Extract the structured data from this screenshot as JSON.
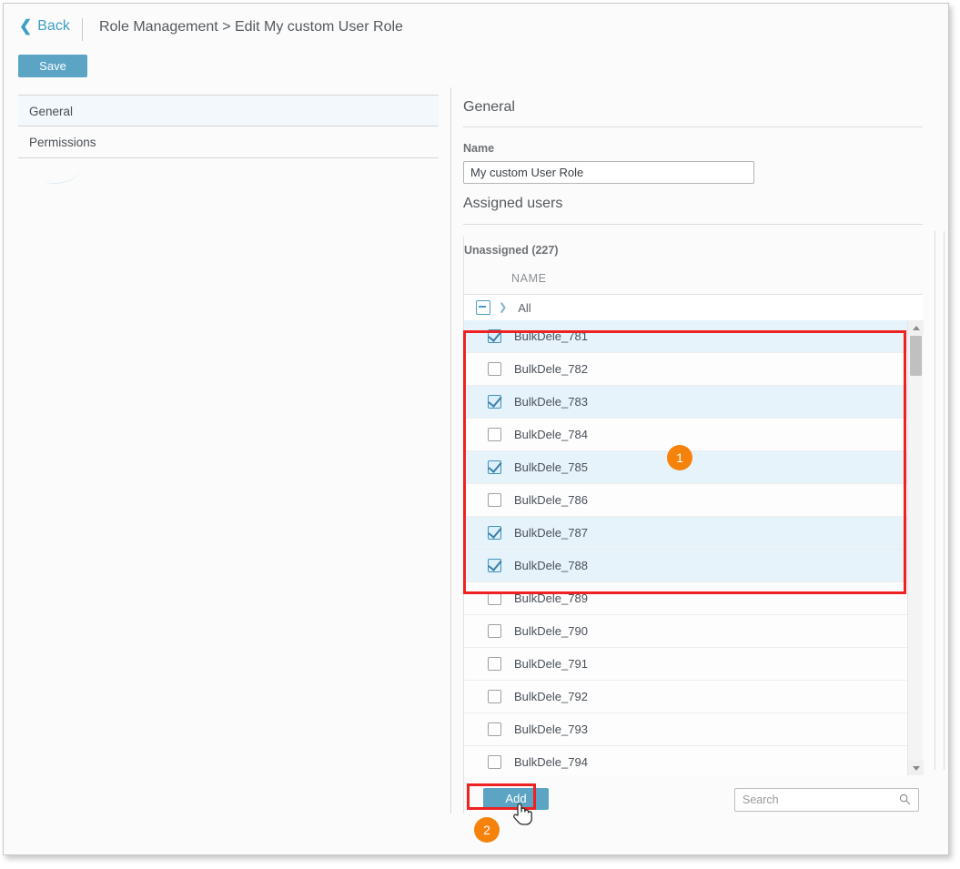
{
  "header": {
    "back_label": "Back",
    "breadcrumb": "Role Management > Edit My custom User Role",
    "save_label": "Save"
  },
  "sidebar": {
    "items": [
      {
        "label": "General",
        "active": true
      },
      {
        "label": "Permissions",
        "active": false
      }
    ]
  },
  "main": {
    "section_general": "General",
    "name_label": "Name",
    "name_value": "My custom User Role",
    "section_assigned": "Assigned users",
    "unassigned_label": "Unassigned (227)",
    "column_header": "NAME",
    "select_all_label": "All",
    "add_label": "Add",
    "search_placeholder": "Search",
    "users": [
      {
        "name": "BulkDele_781",
        "checked": true
      },
      {
        "name": "BulkDele_782",
        "checked": false
      },
      {
        "name": "BulkDele_783",
        "checked": true
      },
      {
        "name": "BulkDele_784",
        "checked": false
      },
      {
        "name": "BulkDele_785",
        "checked": true
      },
      {
        "name": "BulkDele_786",
        "checked": false
      },
      {
        "name": "BulkDele_787",
        "checked": true
      },
      {
        "name": "BulkDele_788",
        "checked": true
      },
      {
        "name": "BulkDele_789",
        "checked": false
      },
      {
        "name": "BulkDele_790",
        "checked": false
      },
      {
        "name": "BulkDele_791",
        "checked": false
      },
      {
        "name": "BulkDele_792",
        "checked": false
      },
      {
        "name": "BulkDele_793",
        "checked": false
      },
      {
        "name": "BulkDele_794",
        "checked": false
      }
    ]
  },
  "annotations": {
    "badge_1": "1",
    "badge_2": "2"
  },
  "colors": {
    "accent": "#5ba4c4",
    "link": "#3d9fc4",
    "badge": "#f5820b",
    "highlight": "#ee2222",
    "row_selected": "#e6f3fb"
  }
}
